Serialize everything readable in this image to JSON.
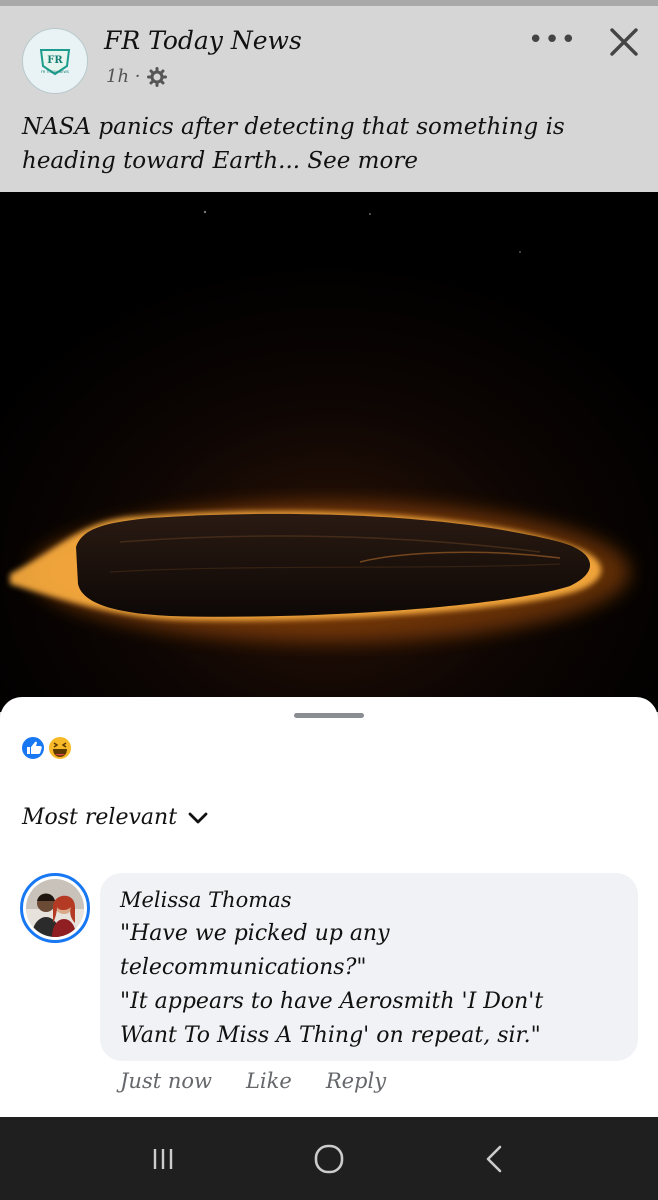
{
  "post": {
    "page_name": "FR Today News",
    "time": "1h ·",
    "text": "NASA panics after detecting that something is heading toward Earth... See more",
    "text_line1": "NASA panics after detecting that something is",
    "text_line2": "heading toward Earth... See more",
    "logo_text": "FR",
    "logo_subtext": "FR TODAY NEWS"
  },
  "comments": {
    "sort_label": "Most relevant",
    "items": [
      {
        "author": "Melissa Thomas",
        "lines": [
          "\"Have we picked up any",
          "telecommunications?\"",
          "\"It appears to have Aerosmith 'I Don't",
          "Want To Miss A Thing' on repeat, sir.\""
        ],
        "time": "Just now",
        "like_label": "Like",
        "reply_label": "Reply"
      }
    ]
  },
  "icons": {
    "reactions": [
      "like-icon",
      "haha-icon"
    ],
    "header": [
      "more-icon",
      "close-icon",
      "settings-icon"
    ],
    "nav": [
      "recent-apps-icon",
      "home-icon",
      "back-icon"
    ]
  },
  "colors": {
    "accent": "#1877f2",
    "glow": "#ff8a1a"
  }
}
